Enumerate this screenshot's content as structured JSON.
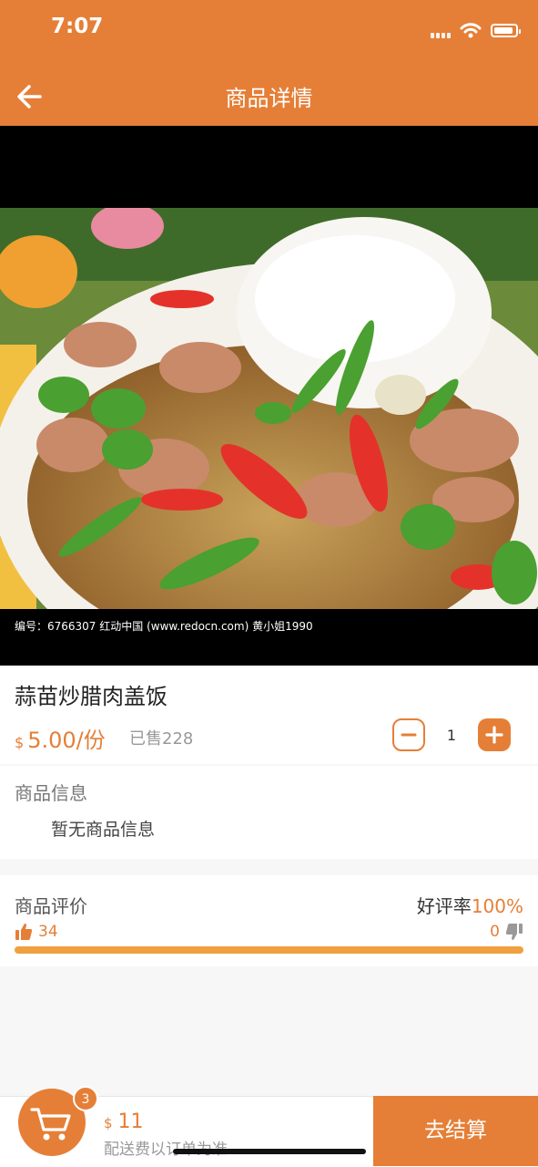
{
  "status_bar": {
    "time": "7:07"
  },
  "header": {
    "title": "商品详情",
    "back_icon": "arrow-left-icon"
  },
  "product": {
    "name": "蒜苗炒腊肉盖饭",
    "currency": "$",
    "price": "5.00/份",
    "sold": "已售228",
    "quantity": "1",
    "image_caption": "编号：6766307   红动中国 (www.redocn.com)   黄小姐1990"
  },
  "info_section": {
    "heading": "商品信息",
    "text": "暂无商品信息"
  },
  "reviews": {
    "heading": "商品评价",
    "rate_label": "好评率",
    "rate_value": "100%",
    "likes": "34",
    "dislikes": "0",
    "positive_fraction": 1.0
  },
  "footer": {
    "cart_badge": "3",
    "currency": "$",
    "total": "11",
    "shipping_note": "配送费以订单为准",
    "checkout_label": "去结算"
  },
  "colors": {
    "accent": "#e57f37",
    "bar": "#f0a040"
  }
}
